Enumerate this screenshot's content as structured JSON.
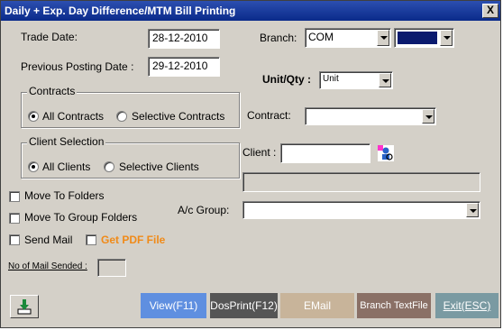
{
  "window": {
    "title": "Daily + Exp. Day Difference/MTM Bill Printing",
    "close_glyph": "X"
  },
  "trade_date": {
    "label": "Trade Date:",
    "value": "28-12-2010"
  },
  "previous_posting_date": {
    "label": "Previous Posting Date :",
    "value": "29-12-2010"
  },
  "branch": {
    "label": "Branch:",
    "value": "COM",
    "color_value_hex": "#0a1a6e"
  },
  "unit_qty": {
    "label": "Unit/Qty :",
    "value": "Unit"
  },
  "contracts": {
    "group_title": "Contracts",
    "option_all": "All Contracts",
    "option_selective": "Selective Contracts",
    "selected": "all"
  },
  "contract": {
    "label": "Contract:",
    "value": ""
  },
  "client_selection": {
    "group_title": "Client Selection",
    "option_all": "All Clients",
    "option_selective": "Selective Clients",
    "selected": "all"
  },
  "client": {
    "label": "Client :",
    "value": "",
    "lookup_icon": "person-search-icon"
  },
  "checkboxes": {
    "move_to_folders": "Move To Folders",
    "move_to_group_folders": "Move To Group Folders",
    "send_mail": "Send Mail",
    "get_pdf_file": "Get PDF File"
  },
  "ac_group": {
    "label": "A/c Group:",
    "value": ""
  },
  "mail_count": {
    "label": "No of Mail Sended :",
    "value": ""
  },
  "buttons": {
    "download_icon": "download-icon",
    "view": "View(F11)",
    "dosprint": "DosPrint(F12)",
    "email": "EMail",
    "branch_textfile": "Branch TextFile",
    "exit": "Exit(ESC)"
  },
  "colors": {
    "pdf_label": "#f08a18",
    "view_btn": "#5f8fe0",
    "dosprint_btn": "#555555",
    "email_btn": "#c8b49a",
    "branch_btn": "#8a7066",
    "exit_btn": "#7a9aa2"
  }
}
